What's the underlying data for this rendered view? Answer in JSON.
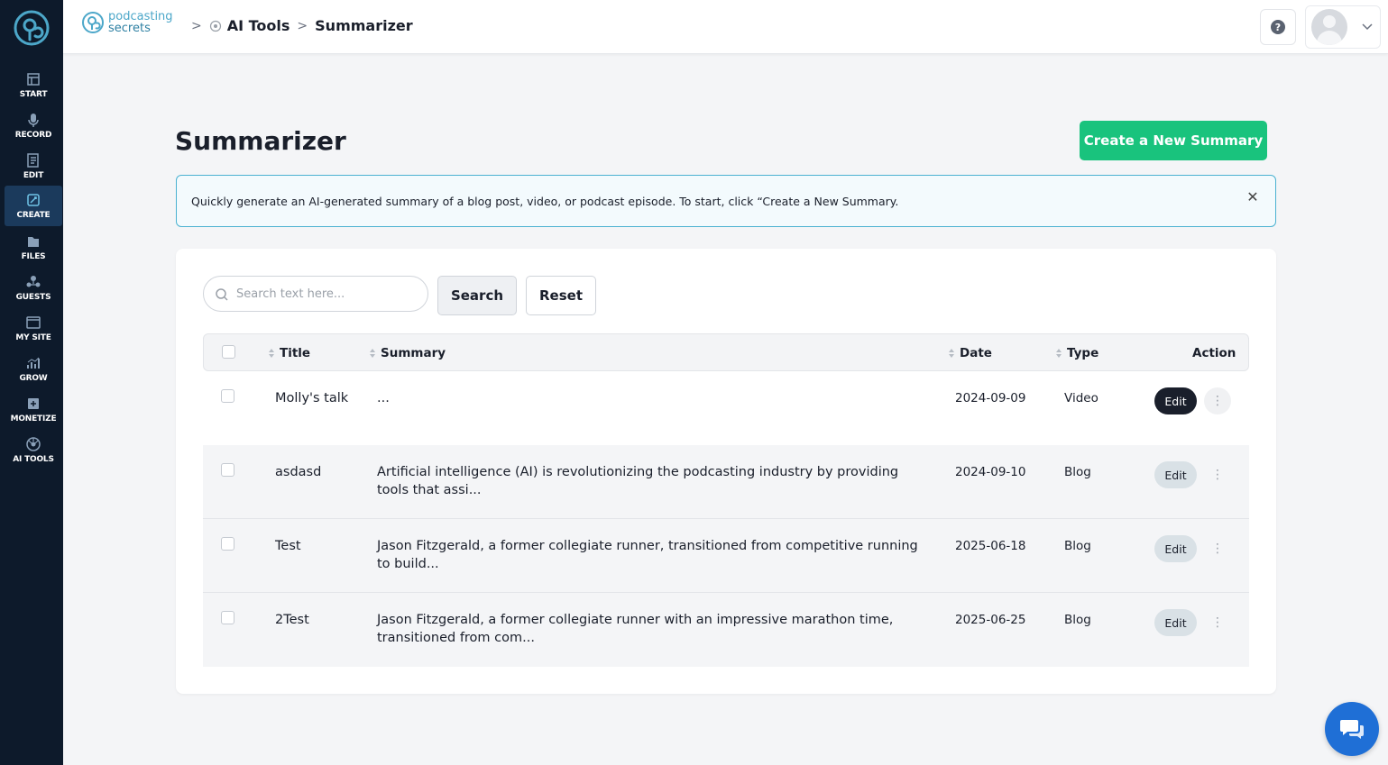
{
  "brand": {
    "line1": "podcasting",
    "line2": "secrets"
  },
  "breadcrumb": {
    "section": "AI Tools",
    "current": "Summarizer"
  },
  "sidebar": {
    "items": [
      {
        "label": "START",
        "icon": "start-icon"
      },
      {
        "label": "RECORD",
        "icon": "microphone-icon"
      },
      {
        "label": "EDIT",
        "icon": "edit-icon"
      },
      {
        "label": "CREATE",
        "icon": "create-icon",
        "active": true
      },
      {
        "label": "FILES",
        "icon": "files-icon"
      },
      {
        "label": "GUESTS",
        "icon": "guests-icon"
      },
      {
        "label": "MY SITE",
        "icon": "site-icon"
      },
      {
        "label": "GROW",
        "icon": "chart-icon"
      },
      {
        "label": "MONETIZE",
        "icon": "monetize-icon"
      },
      {
        "label": "AI TOOLS",
        "icon": "ai-tools-icon"
      }
    ]
  },
  "page": {
    "title": "Summarizer",
    "create_button": "Create a New Summary",
    "info": "Quickly generate an AI-generated summary of a blog post, video, or podcast episode. To start, click “Create a New Summary.",
    "info_close": "✕"
  },
  "search": {
    "placeholder": "Search text here...",
    "value": "",
    "search_label": "Search",
    "reset_label": "Reset"
  },
  "table": {
    "columns": {
      "title": "Title",
      "summary": "Summary",
      "date": "Date",
      "type": "Type",
      "action": "Action"
    },
    "rows": [
      {
        "title": "Molly's talk",
        "summary": "...",
        "date": "2024-09-09",
        "type": "Video",
        "edit": "Edit"
      },
      {
        "title": "asdasd",
        "summary": "Artificial intelligence (AI) is revolutionizing the podcasting industry by providing tools that assi...",
        "date": "2024-09-10",
        "type": "Blog",
        "edit": "Edit"
      },
      {
        "title": "Test",
        "summary": "Jason Fitzgerald, a former collegiate runner, transitioned from competitive running to build...",
        "date": "2025-06-18",
        "type": "Blog",
        "edit": "Edit"
      },
      {
        "title": "2Test",
        "summary": "Jason Fitzgerald, a former collegiate runner with an impressive marathon time, transitioned from com...",
        "date": "2025-06-25",
        "type": "Blog",
        "edit": "Edit"
      }
    ]
  },
  "colors": {
    "sidebar": "#0d1a2b",
    "accent_green": "#19c37d",
    "info_border": "#4bb2d1",
    "chat_blue": "#1f6fd6"
  }
}
